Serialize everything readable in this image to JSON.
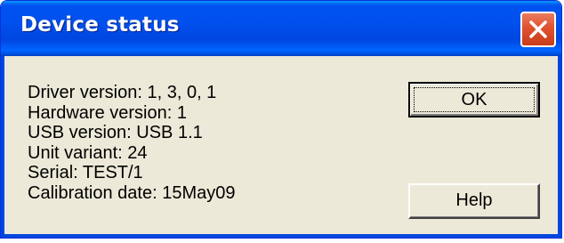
{
  "window": {
    "title": "Device status"
  },
  "info": {
    "driver_version": "Driver version: 1, 3, 0, 1",
    "hardware_version": "Hardware version: 1",
    "usb_version": "USB version: USB 1.1",
    "unit_variant": "Unit variant: 24",
    "serial": "Serial: TEST/1",
    "calibration_date": "Calibration date: 15May09"
  },
  "buttons": {
    "ok_label": "OK",
    "help_label": "Help"
  },
  "icons": {
    "close": "close-icon"
  },
  "colors": {
    "titlebar": "#0050ee",
    "close_button": "#e0512f",
    "dialog_background": "#ece9d8"
  }
}
